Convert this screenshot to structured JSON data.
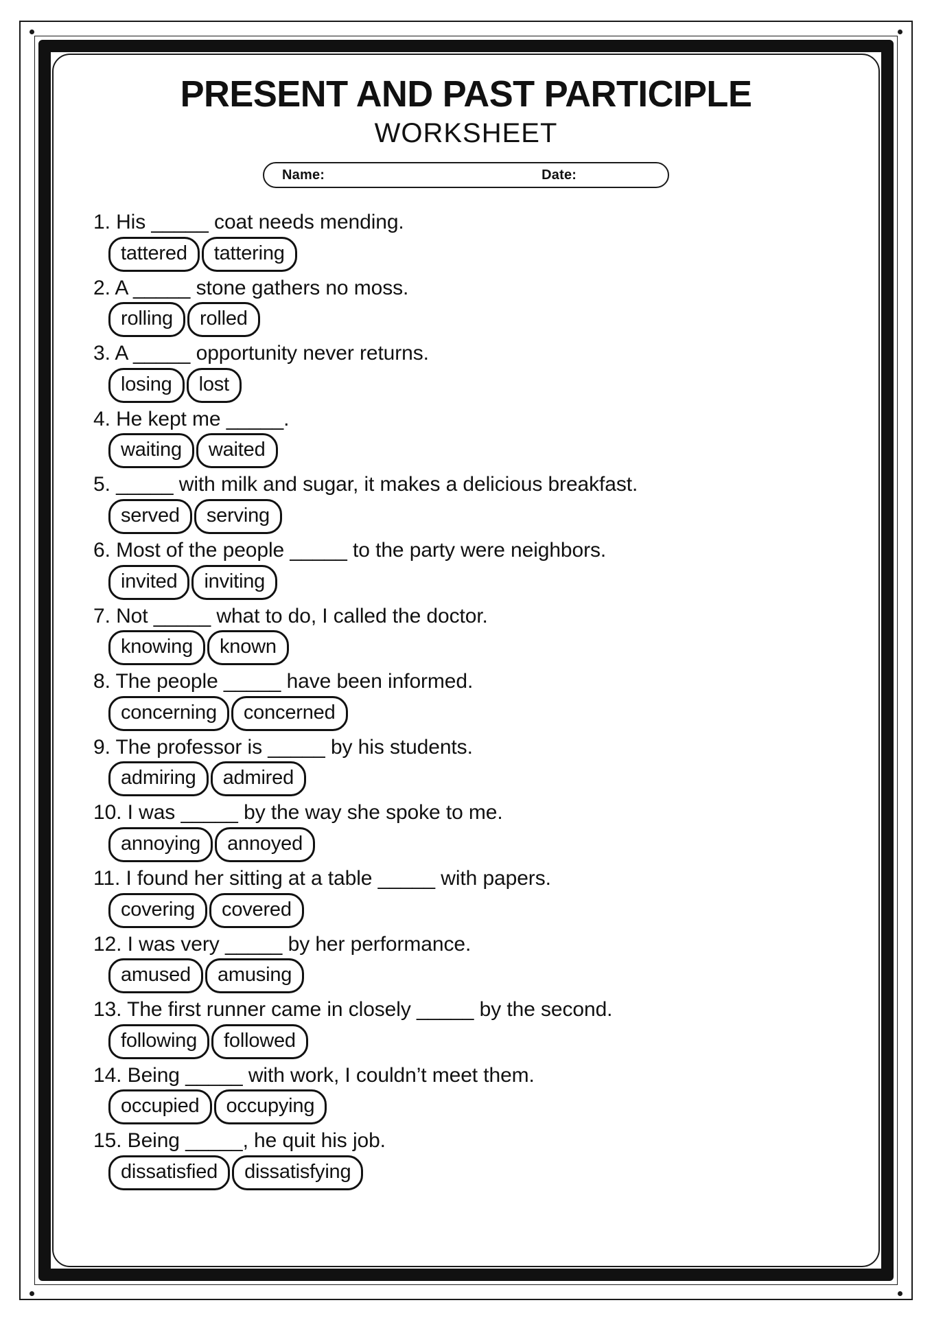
{
  "document": {
    "title": "PRESENT AND PAST PARTICIPLE",
    "subtitle": "WORKSHEET"
  },
  "namebar": {
    "name_label": "Name:",
    "date_label": "Date:"
  },
  "questions": [
    {
      "number": "1.",
      "text_before": "His",
      "blank": "_____",
      "text_after": "coat needs mending.",
      "choices": [
        "tattered",
        "tattering"
      ]
    },
    {
      "number": "2.",
      "text_before": "A",
      "blank": "_____",
      "text_after": "stone gathers no moss.",
      "choices": [
        "rolling",
        "rolled"
      ]
    },
    {
      "number": "3.",
      "text_before": "A",
      "blank": "_____",
      "text_after": "opportunity never returns.",
      "choices": [
        "losing",
        "lost"
      ]
    },
    {
      "number": "4.",
      "text_before": "He kept me",
      "blank": "_____",
      "text_after": ".",
      "choices": [
        "waiting",
        "waited"
      ]
    },
    {
      "number": "5.",
      "text_before": "",
      "blank": "_____",
      "text_after": "with milk and sugar, it makes a delicious breakfast.",
      "choices": [
        "served",
        "serving"
      ]
    },
    {
      "number": "6.",
      "text_before": "Most of the people",
      "blank": "_____",
      "text_after": "to the party were neighbors.",
      "choices": [
        "invited",
        "inviting"
      ]
    },
    {
      "number": "7.",
      "text_before": "Not",
      "blank": "_____",
      "text_after": "what to do, I called the doctor.",
      "choices": [
        "knowing",
        "known"
      ]
    },
    {
      "number": "8.",
      "text_before": "The people",
      "blank": "_____",
      "text_after": "have been informed.",
      "choices": [
        "concerning",
        "concerned"
      ]
    },
    {
      "number": "9.",
      "text_before": "The professor is",
      "blank": "_____",
      "text_after": "by his students.",
      "choices": [
        "admiring",
        "admired"
      ]
    },
    {
      "number": "10.",
      "text_before": "I was",
      "blank": "_____",
      "text_after": "by the way she spoke to me.",
      "choices": [
        "annoying",
        "annoyed"
      ]
    },
    {
      "number": "11.",
      "text_before": "I found her sitting at a table",
      "blank": "_____",
      "text_after": "with papers.",
      "choices": [
        "covering",
        "covered"
      ]
    },
    {
      "number": "12.",
      "text_before": "I was very",
      "blank": "_____",
      "text_after": "by her performance.",
      "choices": [
        "amused",
        "amusing"
      ]
    },
    {
      "number": "13.",
      "text_before": "The first runner came in closely",
      "blank": "_____",
      "text_after": "by the second.",
      "choices": [
        "following",
        "followed"
      ]
    },
    {
      "number": "14.",
      "text_before": "Being",
      "blank": "_____",
      "text_after": "with work, I couldn’t meet them.",
      "choices": [
        "occupied",
        "occupying"
      ]
    },
    {
      "number": "15.",
      "text_before": "Being",
      "blank": "_____",
      "text_after": ", he quit his job.",
      "choices": [
        "dissatisfied",
        "dissatisfying"
      ]
    }
  ],
  "colors": {
    "ink": "#111111",
    "paper": "#ffffff"
  }
}
